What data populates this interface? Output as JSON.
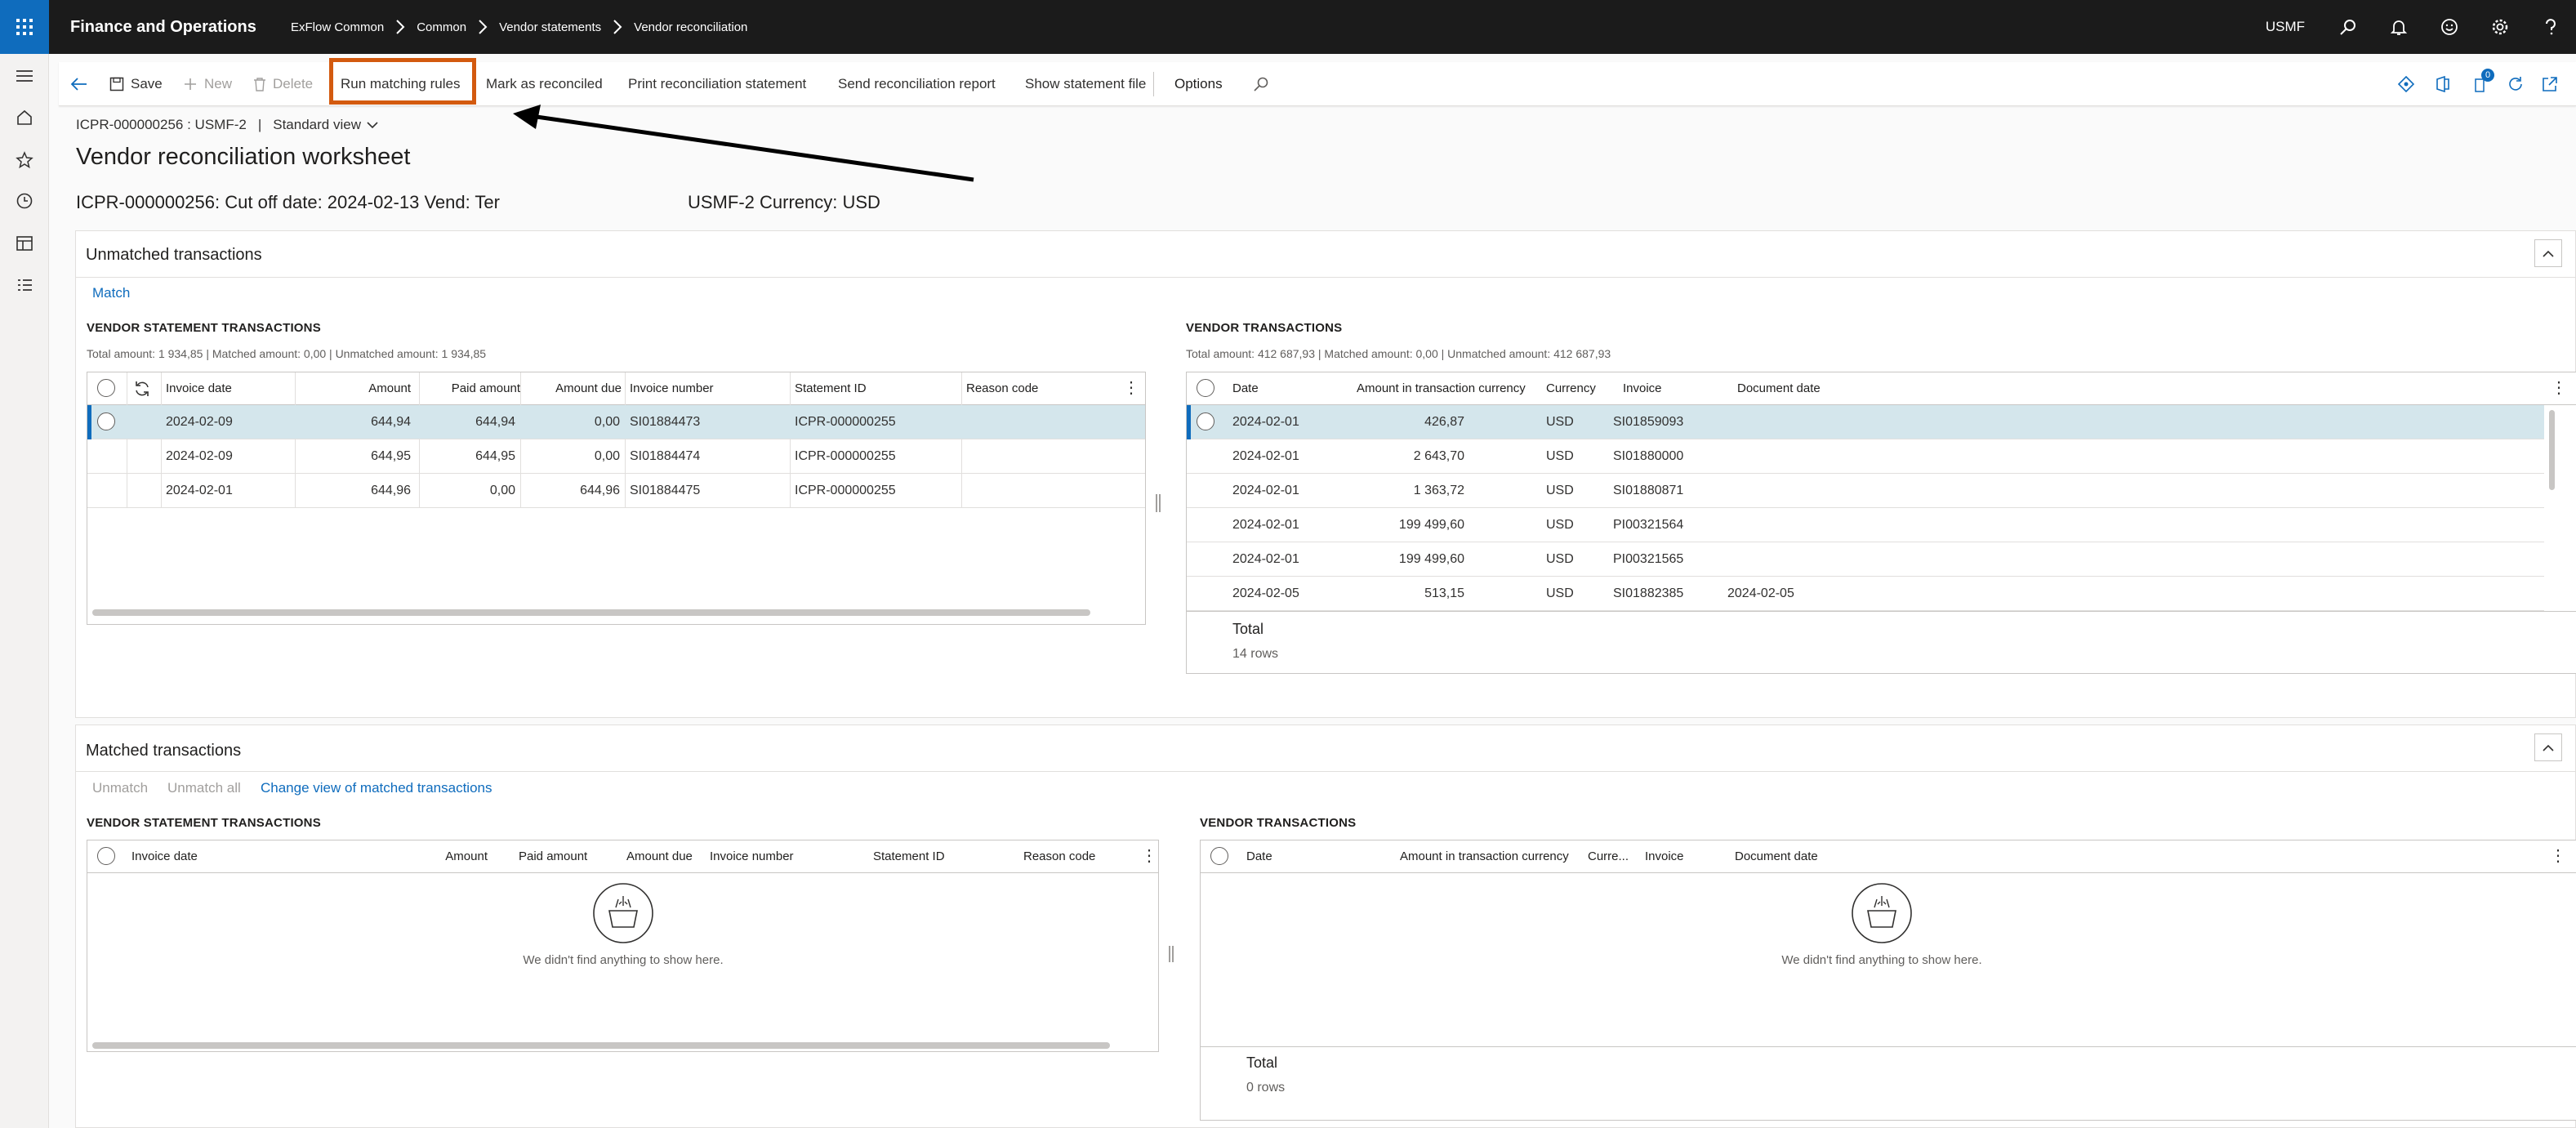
{
  "topbar": {
    "app_name": "Finance and Operations",
    "breadcrumb": [
      "ExFlow Common",
      "Common",
      "Vendor statements",
      "Vendor reconciliation"
    ],
    "company": "USMF"
  },
  "actions": {
    "save": "Save",
    "new": "New",
    "delete": "Delete",
    "run_matching_rules": "Run matching rules",
    "mark_reconciled": "Mark as reconciled",
    "print_statement": "Print reconciliation statement",
    "send_report": "Send reconciliation report",
    "show_file": "Show statement file",
    "options": "Options",
    "badge_count": "0"
  },
  "header": {
    "record_id": "ICPR-000000256 : USMF-2",
    "separator": "|",
    "view": "Standard view",
    "title": "Vendor reconciliation worksheet",
    "subtitle_left": "ICPR-000000256: Cut off date: 2024-02-13 Vend: Ter",
    "subtitle_right": "USMF-2 Currency: USD"
  },
  "unmatched": {
    "title": "Unmatched transactions",
    "match_label": "Match",
    "statement": {
      "title": "VENDOR STATEMENT TRANSACTIONS",
      "summary": "Total amount: 1 934,85 | Matched amount: 0,00 | Unmatched amount: 1 934,85",
      "columns": [
        "Invoice date",
        "Amount",
        "Paid amount",
        "Amount due",
        "Invoice number",
        "Statement ID",
        "Reason code"
      ],
      "rows": [
        [
          "2024-02-09",
          "644,94",
          "644,94",
          "0,00",
          "SI01884473",
          "ICPR-000000255",
          ""
        ],
        [
          "2024-02-09",
          "644,95",
          "644,95",
          "0,00",
          "SI01884474",
          "ICPR-000000255",
          ""
        ],
        [
          "2024-02-01",
          "644,96",
          "0,00",
          "644,96",
          "SI01884475",
          "ICPR-000000255",
          ""
        ]
      ]
    },
    "vendor": {
      "title": "VENDOR TRANSACTIONS",
      "summary": "Total amount: 412 687,93 | Matched amount: 0,00 | Unmatched amount: 412 687,93",
      "columns": [
        "Date",
        "Amount in transaction currency",
        "Currency",
        "Invoice",
        "Document date"
      ],
      "rows": [
        [
          "2024-02-01",
          "426,87",
          "USD",
          "SI01859093",
          ""
        ],
        [
          "2024-02-01",
          "2 643,70",
          "USD",
          "SI01880000",
          ""
        ],
        [
          "2024-02-01",
          "1 363,72",
          "USD",
          "SI01880871",
          ""
        ],
        [
          "2024-02-01",
          "199 499,60",
          "USD",
          "PI00321564",
          ""
        ],
        [
          "2024-02-01",
          "199 499,60",
          "USD",
          "PI00321565",
          ""
        ],
        [
          "2024-02-05",
          "513,15",
          "USD",
          "SI01882385",
          "2024-02-05"
        ]
      ],
      "total_label": "Total",
      "rows_count": "14 rows"
    }
  },
  "matched": {
    "title": "Matched transactions",
    "unmatch": "Unmatch",
    "unmatch_all": "Unmatch all",
    "change_view": "Change view of matched transactions",
    "statement": {
      "title": "VENDOR STATEMENT TRANSACTIONS",
      "columns": [
        "Invoice date",
        "Amount",
        "Paid amount",
        "Amount due",
        "Invoice number",
        "Statement ID",
        "Reason code"
      ],
      "empty": "We didn't find anything to show here."
    },
    "vendor": {
      "title": "VENDOR TRANSACTIONS",
      "columns": [
        "Date",
        "Amount in transaction currency",
        "Curre...",
        "Invoice",
        "Document date"
      ],
      "empty": "We didn't find anything to show here.",
      "total_label": "Total",
      "rows_count": "0 rows"
    }
  },
  "colors": {
    "accent": "#0f6cbd",
    "highlight": "#d35a0f",
    "selected_row": "#d4e6ec",
    "topbar": "#1b1b1b"
  }
}
